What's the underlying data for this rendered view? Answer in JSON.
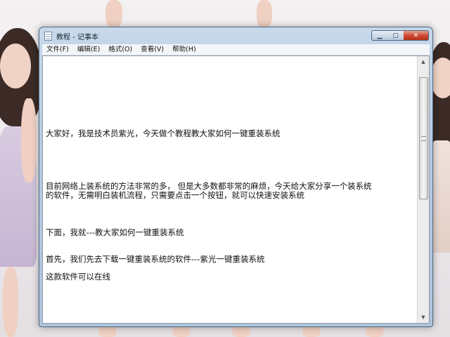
{
  "window": {
    "title": "教程 - 记事本",
    "controls": {
      "minimize": "▁",
      "maximize": "▢",
      "close": "✕"
    },
    "icon": "notepad-icon"
  },
  "menubar": {
    "items": [
      {
        "label": "文件(F)"
      },
      {
        "label": "编辑(E)"
      },
      {
        "label": "格式(O)"
      },
      {
        "label": "查看(V)"
      },
      {
        "label": "帮助(H)"
      }
    ]
  },
  "document": {
    "lines": [
      "大家好，我是技术员紫光，今天做个教程教大家如何一键重装系统",
      "目前网络上装系统的方法非常的多， 但是大多数都非常的麻烦，今天给大家分享一个装系统",
      "的软件，无需明白装机流程，只需要点击一个按钮，就可以快速安装系统",
      "下面，我就---教大家如何一键重装系统",
      "首先，我们先去下载一键重装系统的软件---紫光一键重装系统",
      "这款软件可以在线"
    ]
  },
  "scrollbar": {
    "up": "▲",
    "down": "▼"
  },
  "colors": {
    "titlebar": "#b6cbe0",
    "close": "#c9452e",
    "editor_bg": "#ffffff"
  }
}
